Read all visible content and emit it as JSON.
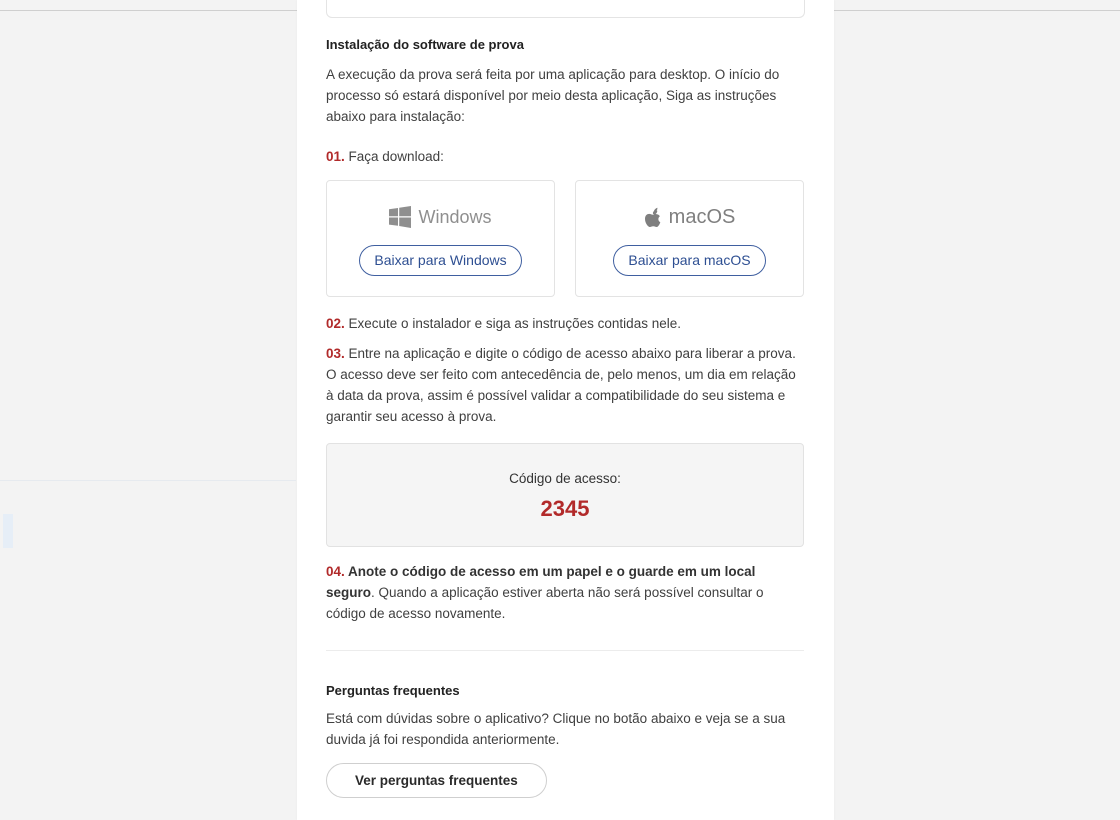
{
  "install": {
    "title": "Instalação do software de prova",
    "intro": "A execução da prova será feita por uma aplicação para desktop. O início do processo só estará disponível por meio desta aplicação, Siga as instruções abaixo para instalação:"
  },
  "steps": {
    "s1_num": "01.",
    "s1_text": " Faça download:",
    "s2_num": "02.",
    "s2_text": " Execute o instalador e siga as instruções contidas nele.",
    "s3_num": "03.",
    "s3_text": " Entre na aplicação e digite o código de acesso abaixo para liberar a prova. O acesso deve ser feito com antecedência de, pelo menos, um dia em relação à data da prova, assim é possível validar a compatibilidade do seu sistema e garantir seu acesso à prova.",
    "s4_num": "04.",
    "s4_bold": " Anote o código de acesso em um papel e o guarde em um local seguro",
    "s4_text": ". Quando a aplicação estiver aberta não será possível consultar o código de acesso novamente."
  },
  "downloads": {
    "windows": {
      "os_name": "Windows",
      "icon": "windows-logo-icon",
      "button": "Baixar para Windows"
    },
    "macos": {
      "os_name": "macOS",
      "icon": "apple-logo-icon",
      "button": "Baixar para macOS"
    }
  },
  "access": {
    "label": "Código de acesso:",
    "code": "2345"
  },
  "faq": {
    "title": "Perguntas frequentes",
    "text": "Está com dúvidas sobre o aplicativo? Clique no botão abaixo e veja se a sua duvida já foi respondida anteriormente.",
    "button": "Ver perguntas frequentes"
  },
  "colors": {
    "accent_red": "#b12a2a",
    "link_blue": "#2e4f92",
    "background": "#f3f3f3"
  }
}
